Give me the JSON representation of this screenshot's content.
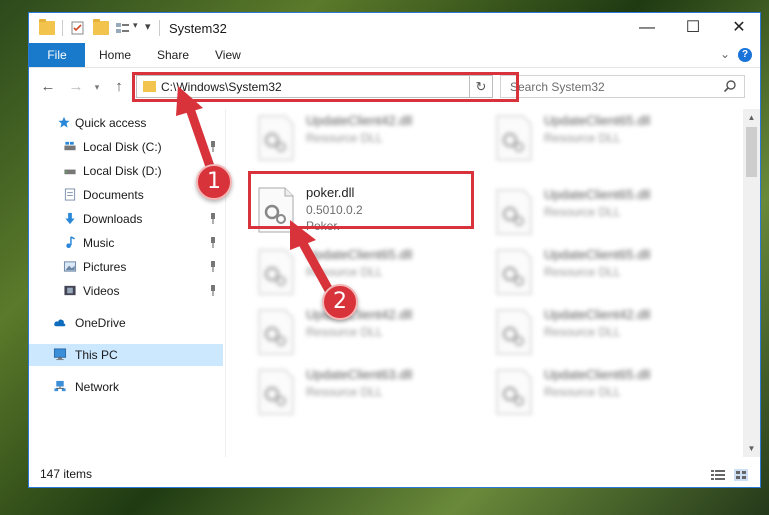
{
  "window": {
    "title": "System32"
  },
  "ribbon": {
    "file": "File",
    "tabs": [
      "Home",
      "Share",
      "View"
    ]
  },
  "nav": {
    "address": "C:\\Windows\\System32",
    "search_placeholder": "Search System32"
  },
  "sidebar": {
    "items": [
      {
        "label": "Quick access",
        "icon": "star-icon",
        "pinned": false
      },
      {
        "label": "Local Disk (C:)",
        "icon": "drive-icon",
        "pinned": true
      },
      {
        "label": "Local Disk (D:)",
        "icon": "drive-icon",
        "pinned": false
      },
      {
        "label": "Documents",
        "icon": "documents-icon",
        "pinned": true
      },
      {
        "label": "Downloads",
        "icon": "download-icon",
        "pinned": true
      },
      {
        "label": "Music",
        "icon": "music-icon",
        "pinned": true
      },
      {
        "label": "Pictures",
        "icon": "pictures-icon",
        "pinned": true
      },
      {
        "label": "Videos",
        "icon": "videos-icon",
        "pinned": true
      },
      {
        "label": "OneDrive",
        "icon": "cloud-icon",
        "pinned": false
      },
      {
        "label": "This PC",
        "icon": "computer-icon",
        "pinned": false,
        "selected": true
      },
      {
        "label": "Network",
        "icon": "network-icon",
        "pinned": false
      }
    ]
  },
  "files": {
    "left": [
      {
        "name": "UpdateClient42.dll",
        "line2": "Resource DLL",
        "line3": "",
        "blur": true
      },
      {
        "name": "poker.dll",
        "line2": "0.5010.0.2",
        "line3": "Poker.",
        "blur": false
      },
      {
        "name": "UpdateClient65.dll",
        "line2": "Resource DLL",
        "line3": "",
        "blur": true
      },
      {
        "name": "UpdateClient42.dll",
        "line2": "Resource DLL",
        "line3": "",
        "blur": true
      },
      {
        "name": "UpdateClient63.dll",
        "line2": "Resource DLL",
        "line3": "",
        "blur": true
      }
    ],
    "right": [
      {
        "name": "UpdateClient65.dll",
        "line2": "Resource DLL",
        "line3": "",
        "blur": true
      },
      {
        "name": "UpdateClient65.dll",
        "line2": "Resource DLL",
        "line3": "",
        "blur": true
      },
      {
        "name": "UpdateClient65.dll",
        "line2": "Resource DLL",
        "line3": "",
        "blur": true
      },
      {
        "name": "UpdateClient42.dll",
        "line2": "Resource DLL",
        "line3": "",
        "blur": true
      },
      {
        "name": "UpdateClient65.dll",
        "line2": "Resource DLL",
        "line3": "",
        "blur": true
      }
    ]
  },
  "status": {
    "items": "147 items"
  },
  "annotations": {
    "step1": "1",
    "step2": "2",
    "highlight_color": "#d8323a"
  }
}
